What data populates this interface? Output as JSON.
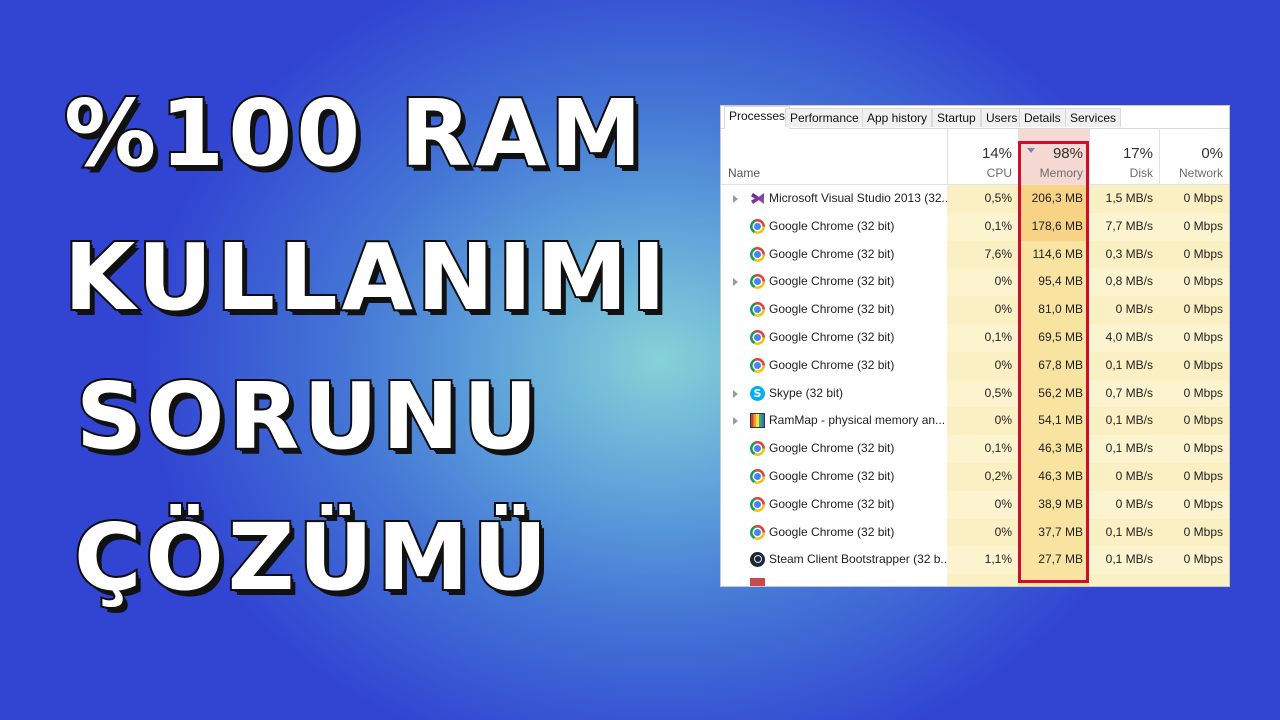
{
  "headline": {
    "line1": "%100 RAM",
    "line2": "KULLANIMI",
    "line3": "SORUNU",
    "line4": "ÇÖZÜMÜ"
  },
  "task_manager": {
    "tabs": [
      {
        "label": "Processes",
        "active": true
      },
      {
        "label": "Performance"
      },
      {
        "label": "App history"
      },
      {
        "label": "Startup"
      },
      {
        "label": "Users"
      },
      {
        "label": "Details"
      },
      {
        "label": "Services"
      }
    ],
    "columns": {
      "name": {
        "label": "Name"
      },
      "cpu": {
        "label": "CPU",
        "percent": "14%"
      },
      "memory": {
        "label": "Memory",
        "percent": "98%"
      },
      "disk": {
        "label": "Disk",
        "percent": "17%"
      },
      "network": {
        "label": "Network",
        "percent": "0%"
      }
    },
    "highlight_color": "#c8102e",
    "rows": [
      {
        "name": "Microsoft Visual Studio 2013 (32...",
        "icon": "visual-studio-icon",
        "expandable": true,
        "cpu": "0,5%",
        "memory": "206,3 MB",
        "disk": "1,5 MB/s",
        "network": "0 Mbps"
      },
      {
        "name": "Google Chrome (32 bit)",
        "icon": "chrome-icon",
        "expandable": false,
        "cpu": "0,1%",
        "memory": "178,6 MB",
        "disk": "7,7 MB/s",
        "network": "0 Mbps"
      },
      {
        "name": "Google Chrome (32 bit)",
        "icon": "chrome-icon",
        "expandable": false,
        "cpu": "7,6%",
        "memory": "114,6 MB",
        "disk": "0,3 MB/s",
        "network": "0 Mbps"
      },
      {
        "name": "Google Chrome (32 bit)",
        "icon": "chrome-icon",
        "expandable": true,
        "cpu": "0%",
        "memory": "95,4 MB",
        "disk": "0,8 MB/s",
        "network": "0 Mbps"
      },
      {
        "name": "Google Chrome (32 bit)",
        "icon": "chrome-icon",
        "expandable": false,
        "cpu": "0%",
        "memory": "81,0 MB",
        "disk": "0 MB/s",
        "network": "0 Mbps"
      },
      {
        "name": "Google Chrome (32 bit)",
        "icon": "chrome-icon",
        "expandable": false,
        "cpu": "0,1%",
        "memory": "69,5 MB",
        "disk": "4,0 MB/s",
        "network": "0 Mbps"
      },
      {
        "name": "Google Chrome (32 bit)",
        "icon": "chrome-icon",
        "expandable": false,
        "cpu": "0%",
        "memory": "67,8 MB",
        "disk": "0,1 MB/s",
        "network": "0 Mbps"
      },
      {
        "name": "Skype (32 bit)",
        "icon": "skype-icon",
        "expandable": true,
        "cpu": "0,5%",
        "memory": "56,2 MB",
        "disk": "0,7 MB/s",
        "network": "0 Mbps"
      },
      {
        "name": "RamMap - physical memory an...",
        "icon": "rammap-icon",
        "expandable": true,
        "cpu": "0%",
        "memory": "54,1 MB",
        "disk": "0,1 MB/s",
        "network": "0 Mbps"
      },
      {
        "name": "Google Chrome (32 bit)",
        "icon": "chrome-icon",
        "expandable": false,
        "cpu": "0,1%",
        "memory": "46,3 MB",
        "disk": "0,1 MB/s",
        "network": "0 Mbps"
      },
      {
        "name": "Google Chrome (32 bit)",
        "icon": "chrome-icon",
        "expandable": false,
        "cpu": "0,2%",
        "memory": "46,3 MB",
        "disk": "0 MB/s",
        "network": "0 Mbps"
      },
      {
        "name": "Google Chrome (32 bit)",
        "icon": "chrome-icon",
        "expandable": false,
        "cpu": "0%",
        "memory": "38,9 MB",
        "disk": "0 MB/s",
        "network": "0 Mbps"
      },
      {
        "name": "Google Chrome (32 bit)",
        "icon": "chrome-icon",
        "expandable": false,
        "cpu": "0%",
        "memory": "37,7 MB",
        "disk": "0,1 MB/s",
        "network": "0 Mbps"
      },
      {
        "name": "Steam Client Bootstrapper (32 b...",
        "icon": "steam-icon",
        "expandable": false,
        "cpu": "1,1%",
        "memory": "27,7 MB",
        "disk": "0,1 MB/s",
        "network": "0 Mbps"
      }
    ]
  }
}
